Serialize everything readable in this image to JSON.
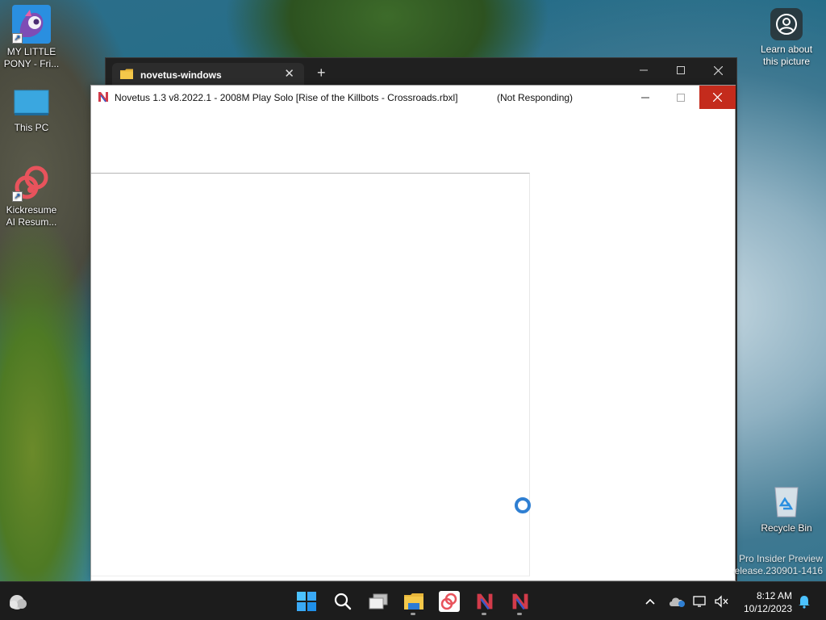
{
  "desktop": {
    "icons": [
      {
        "label": "MY LITTLE PONY - Fri..."
      },
      {
        "label": "This PC"
      },
      {
        "label": "Kickresume AI Resum..."
      },
      {
        "label": "Recycle Bin"
      }
    ],
    "learn_label": "Learn about this picture",
    "watermark_line1": "Pro Insider Preview",
    "watermark_line2": "elease.230901-1416"
  },
  "explorer": {
    "tab_title": "novetus-windows",
    "tab_close": "✕",
    "new_tab": "+"
  },
  "novetus": {
    "title": "Novetus 1.3 v8.2022.1 - 2008M Play Solo [Rise of the Killbots - Crossroads.rbxl]",
    "status": "(Not Responding)"
  },
  "taskbar": {
    "time": "8:12 AM",
    "date": "10/12/2023"
  },
  "colors": {
    "close_red": "#c42b1c",
    "accent_blue": "#2f7fd2",
    "taskbar_bg": "#1c1c1c"
  }
}
